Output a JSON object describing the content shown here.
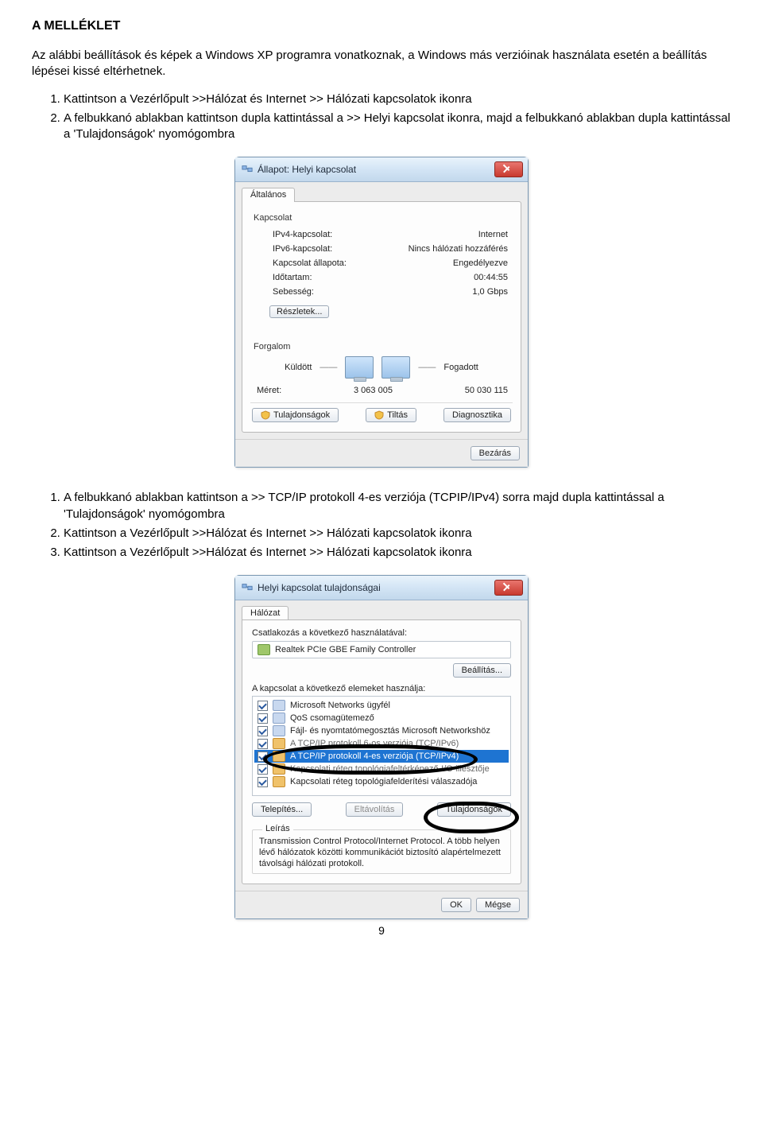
{
  "heading": "A MELLÉKLET",
  "intro": "Az alábbi beállítások és képek a Windows XP programra vonatkoznak, a Windows más verzióinak használata esetén a beállítás lépései kissé eltérhetnek.",
  "list1": [
    "Kattintson a Vezérlőpult >>Hálózat és Internet >> Hálózati kapcsolatok ikonra",
    "A felbukkanó ablakban kattintson dupla kattintással a >> Helyi kapcsolat ikonra, majd a felbukkanó ablakban dupla kattintással a 'Tulajdonságok' nyomógombra"
  ],
  "dialog1": {
    "title": "Állapot: Helyi kapcsolat",
    "tab": "Általános",
    "group_conn": "Kapcsolat",
    "rows": [
      {
        "k": "IPv4-kapcsolat:",
        "v": "Internet"
      },
      {
        "k": "IPv6-kapcsolat:",
        "v": "Nincs hálózati hozzáférés"
      },
      {
        "k": "Kapcsolat állapota:",
        "v": "Engedélyezve"
      },
      {
        "k": "Időtartam:",
        "v": "00:44:55"
      },
      {
        "k": "Sebesség:",
        "v": "1,0 Gbps"
      }
    ],
    "details": "Részletek...",
    "group_traffic": "Forgalom",
    "sent": "Küldött",
    "recv": "Fogadott",
    "meret": "Méret:",
    "sent_val": "3 063 005",
    "recv_val": "50 030 115",
    "btn_props": "Tulajdonságok",
    "btn_disable": "Tiltás",
    "btn_diag": "Diagnosztika",
    "btn_close": "Bezárás"
  },
  "list2": [
    "A felbukkanó ablakban kattintson a >> TCP/IP protokoll 4-es verziója (TCPIP/IPv4) sorra majd dupla kattintással a 'Tulajdonságok' nyomógombra",
    "Kattintson a Vezérlőpult >>Hálózat és Internet >> Hálózati kapcsolatok ikonra",
    "Kattintson a Vezérlőpult >>Hálózat és Internet >> Hálózati kapcsolatok ikonra"
  ],
  "dialog2": {
    "title": "Helyi kapcsolat tulajdonságai",
    "tab": "Hálózat",
    "connect_label": "Csatlakozás a következő használatával:",
    "nic": "Realtek PCIe GBE Family Controller",
    "btn_config": "Beállítás...",
    "uses_label": "A kapcsolat a következő elemeket használja:",
    "items": [
      "Microsoft Networks ügyfél",
      "QoS csomagütemező",
      "Fájl- és nyomtatómegosztás Microsoft Networkshöz",
      "A TCP/IP protokoll 6-os verziója (TCP/IPv6)",
      "A TCP/IP protokoll 4-es verziója (TCP/IPv4)",
      "Kapcsolati réteg topológiafeltérképező-I/O-illesztője",
      "Kapcsolati réteg topológiafelderítési válaszadója"
    ],
    "btn_install": "Telepítés...",
    "btn_remove": "Eltávolítás",
    "btn_props": "Tulajdonságok",
    "desc_label": "Leírás",
    "desc_text": "Transmission Control Protocol/Internet Protocol. A több helyen lévő hálózatok közötti kommunikációt biztosító alapértelmezett távolsági hálózati protokoll.",
    "btn_ok": "OK",
    "btn_cancel": "Mégse"
  },
  "page_number": "9"
}
